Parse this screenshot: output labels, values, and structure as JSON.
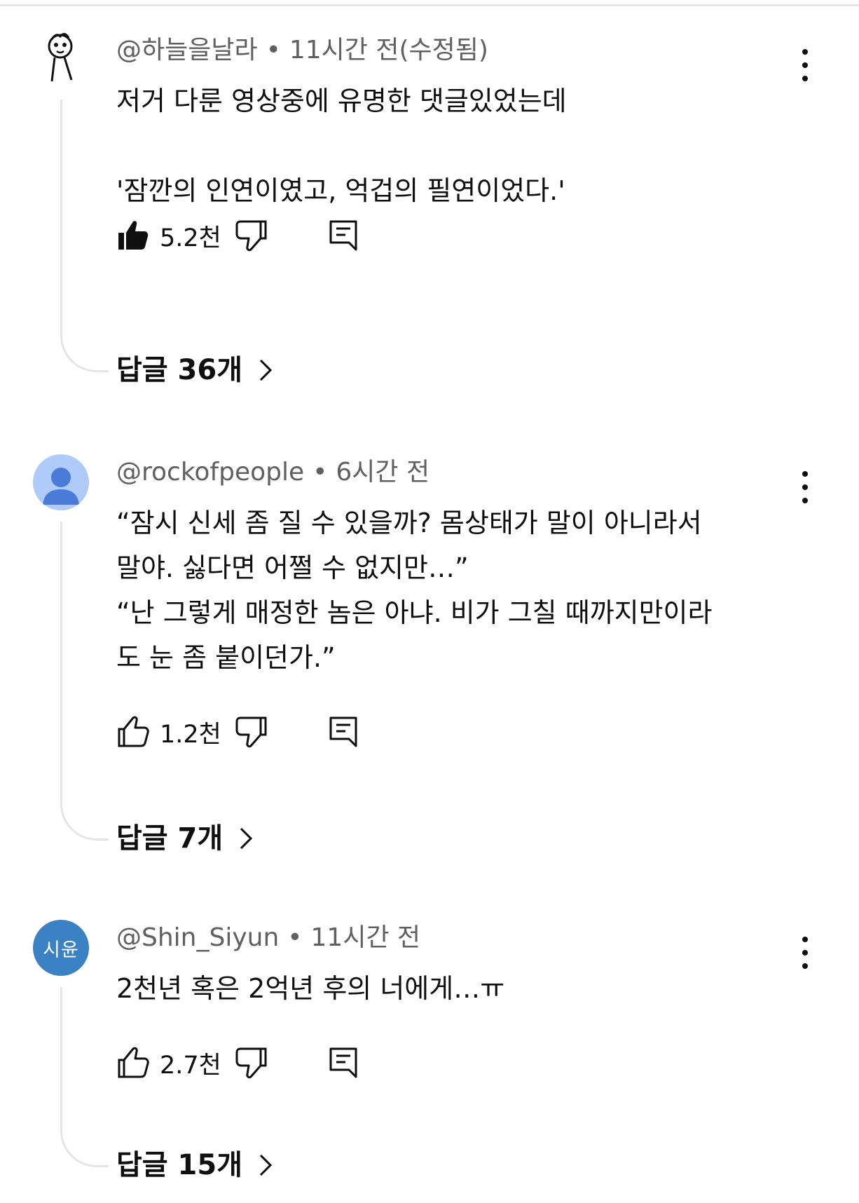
{
  "comments": [
    {
      "author": "@하늘을날라",
      "time": "11시간 전(수정됨)",
      "body_lines": [
        "저거 다룬 영상중에 유명한 댓글있었는데",
        "",
        "'잠깐의 인연이였고, 억겁의 필연이었다.'"
      ],
      "likes": "5.2천",
      "liked": true,
      "replies": "답글 36개",
      "avatar_type": "doodle"
    },
    {
      "author": "@rockofpeople",
      "time": "6시간 전",
      "body_lines": [
        "“잠시 신세 좀 질 수 있을까? 몸상태가 말이 아니라서",
        "말야. 싫다면 어쩔 수 없지만…”",
        "“난 그렇게 매정한 놈은 아냐. 비가 그칠 때까지만이라",
        "도 눈 좀 붙이던가.”"
      ],
      "likes": "1.2천",
      "liked": false,
      "replies": "답글 7개",
      "avatar_type": "default"
    },
    {
      "author": "@Shin_Siyun",
      "time": "11시간 전",
      "body_lines": [
        "2천년 혹은 2억년 후의 너에게…ㅠ"
      ],
      "likes": "2.7천",
      "liked": false,
      "replies": "답글 15개",
      "avatar_type": "initial",
      "avatar_text": "시윤"
    }
  ],
  "icons": {
    "like": "thumbs-up-icon",
    "dislike": "thumbs-down-icon",
    "reply": "reply-comment-icon",
    "more": "more-vertical-icon",
    "chevron": "chevron-right-icon"
  },
  "colors": {
    "text": "#0f0f0f",
    "meta": "#606060",
    "thread_line": "#e5e5e5",
    "avatar_default_bg": "#aecbfa",
    "avatar_default_fg": "#4a7bd8",
    "avatar_initial_bg": "#3b82c4"
  }
}
